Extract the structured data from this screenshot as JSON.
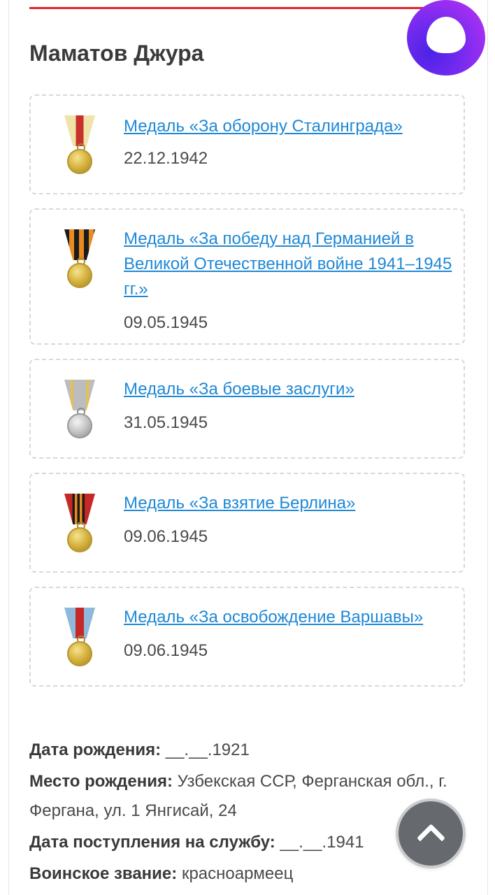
{
  "colors": {
    "accent_red": "#e3242b",
    "link": "#1e88d6",
    "alice_gradient": [
      "#4b23e6",
      "#c033f2"
    ]
  },
  "person": {
    "name": "Маматов Джура"
  },
  "awards": [
    {
      "title": "Медаль «За оборону Сталинграда»",
      "date": "22.12.1942",
      "medal_icon": "medal-defense-stalingrad-icon",
      "ribbon_colors": [
        "#efe3a8",
        "#c8312b"
      ]
    },
    {
      "title": "Медаль «За победу над Германией в Великой Отечественной войне 1941–1945 гг.»",
      "date": "09.05.1945",
      "medal_icon": "medal-victory-over-germany-icon",
      "ribbon_colors": [
        "#1b1b1b",
        "#e98b1f"
      ]
    },
    {
      "title": "Медаль «За боевые заслуги»",
      "date": "31.05.1945",
      "medal_icon": "medal-combat-merit-icon",
      "ribbon_colors": [
        "#bdbdbd",
        "#e8c04a"
      ]
    },
    {
      "title": "Медаль «За взятие Берлина»",
      "date": "09.06.1945",
      "medal_icon": "medal-capture-berlin-icon",
      "ribbon_colors": [
        "#c62828",
        "#1b1b1b",
        "#e98b1f"
      ]
    },
    {
      "title": "Медаль «За освобождение Варшавы»",
      "date": "09.06.1945",
      "medal_icon": "medal-liberation-warsaw-icon",
      "ribbon_colors": [
        "#8fb8dc",
        "#c62828"
      ]
    }
  ],
  "info": {
    "birth_date_label": "Дата рождения:",
    "birth_date_value": "__.__.1921",
    "birth_place_label": "Место рождения:",
    "birth_place_value": "Узбекская ССР, Ферганская обл., г. Фергана, ул. 1 Янгисай, 24",
    "service_start_label": "Дата поступления на службу:",
    "service_start_value": "__.__.1941",
    "rank_label": "Воинское звание:",
    "rank_value": "красноармеец"
  },
  "icons": {
    "alice": "alice-assistant-icon",
    "scroll_top": "chevron-up-icon"
  }
}
